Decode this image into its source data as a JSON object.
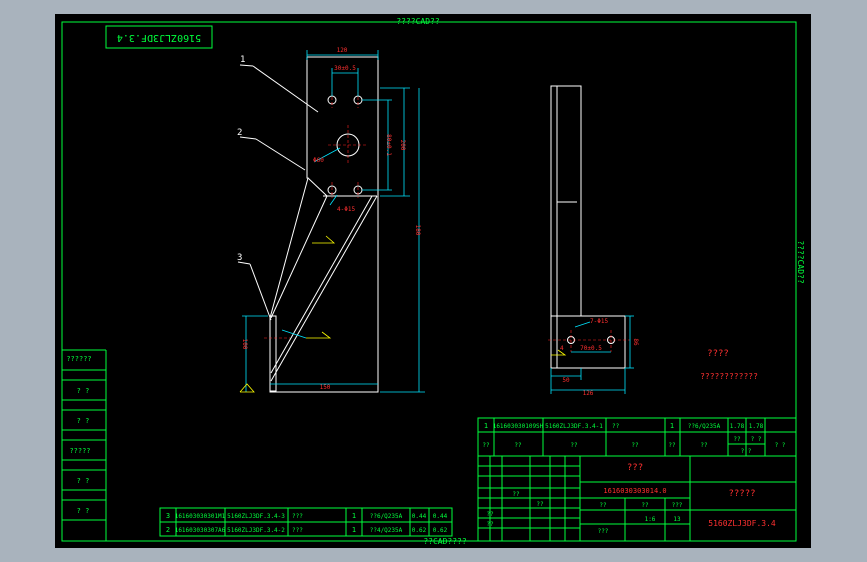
{
  "header": {
    "top_caption": "????CAD??",
    "bottom_caption": "??CAD????",
    "side_caption": "????CAD??"
  },
  "title_stamp": "5160ZLJ3DF.3.4",
  "left_column": [
    "??????",
    "? ?",
    "? ?",
    "?????",
    "? ?",
    "? ?"
  ],
  "part_labels": [
    "1",
    "2",
    "3"
  ],
  "dims": {
    "d120": "120",
    "d30": "30±0.5",
    "d200": "200",
    "d80": "80±0.1",
    "phi60": "Φ60",
    "holes": "4-Φ15",
    "d150": "150",
    "d100": "100",
    "d180": "180",
    "s7": "7-Φ15",
    "s70": "70±0.5",
    "s4": "4",
    "s86": "86",
    "s50": "50",
    "s126": "126"
  },
  "notes": {
    "title": "????",
    "body": "????????????"
  },
  "bom_top": {
    "index": "1",
    "code": "161603030109SH",
    "name": "5160ZLJ3DF.3.4-1",
    "desc": "??",
    "qty": "1",
    "material": "??6/Q235A",
    "w1": "1.78",
    "w2": "1.78"
  },
  "bom_header": [
    "??",
    "??",
    "??",
    "??",
    "??",
    "??",
    "??",
    "? ?",
    "? ?",
    "? ?"
  ],
  "bom_bottom": [
    {
      "index": "3",
      "code": "161603030301M1",
      "name": "5160ZLJ3DF.3.4-3",
      "desc": "???",
      "qty": "1",
      "material": "??6/Q235A",
      "w1": "0.44",
      "w2": "0.44"
    },
    {
      "index": "2",
      "code": "161603030307A6",
      "name": "5160ZLJ3DF.3.4-2",
      "desc": "???",
      "qty": "1",
      "material": "??4/Q235A",
      "w1": "0.62",
      "w2": "0.62"
    }
  ],
  "title_block": {
    "drawing_name": "???",
    "drawing_code": "1616030303014.0",
    "company": "?????",
    "drawing_no": "5160ZLJ3DF.3.4",
    "scale": "1:6",
    "sheets": "13",
    "small_labels": [
      "??",
      "??",
      "???",
      "???",
      "??",
      "??",
      "??",
      "??"
    ]
  }
}
